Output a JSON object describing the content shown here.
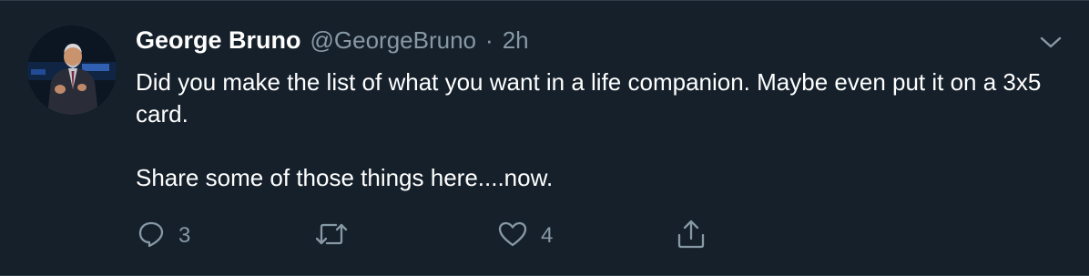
{
  "tweet": {
    "author_name": "George Bruno",
    "author_handle": "@GeorgeBruno",
    "separator": "·",
    "time": "2h",
    "text_line_1": "Did you make the list of what you want in a life companion. Maybe even put it on a 3x5 card.",
    "text_line_2": "Share some of those things here....now.",
    "reply_count": "3",
    "retweet_count": "",
    "like_count": "4"
  },
  "icons": {
    "reply": "reply-icon",
    "retweet": "retweet-icon",
    "like": "heart-icon",
    "share": "share-icon",
    "menu": "chevron-down-icon"
  },
  "colors": {
    "background": "#15202b",
    "text_primary": "#ffffff",
    "text_secondary": "#8899a6",
    "divider": "#2f3d4a"
  }
}
